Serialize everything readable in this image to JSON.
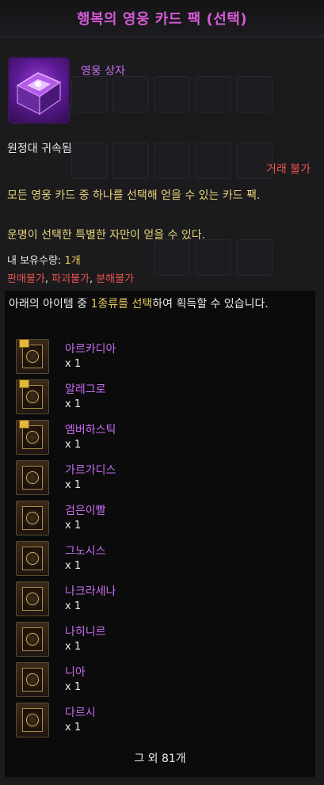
{
  "title": "행복의 영웅 카드 팩 (선택)",
  "item": {
    "name": "영웅 상자",
    "icon": "purple-card-box-icon"
  },
  "bound_text": "원정대 귀속됨",
  "trade_text": "거래 불가",
  "description": [
    "모든 영웅 카드 중 하나를 선택해 얻을 수 있는 카드 팩.",
    "운명이 선택한 특별한 자만이 얻을 수 있다."
  ],
  "owned": {
    "label": "내 보유수량: ",
    "count": "1개"
  },
  "restrictions": [
    "판매불가",
    "파괴불가",
    "분해불가"
  ],
  "panel": {
    "intro_before": "아래의 아이템 중 ",
    "intro_highlight": "1종류를 선택",
    "intro_after": "하여 획득할 수 있습니다.",
    "items": [
      {
        "name": "아르카디아",
        "qty": "x 1",
        "flag": true
      },
      {
        "name": "알레그로",
        "qty": "x 1",
        "flag": true
      },
      {
        "name": "엠버하스틱",
        "qty": "x 1",
        "flag": true
      },
      {
        "name": "가르가디스",
        "qty": "x 1",
        "flag": false
      },
      {
        "name": "검은이빨",
        "qty": "x 1",
        "flag": false
      },
      {
        "name": "그노시스",
        "qty": "x 1",
        "flag": false
      },
      {
        "name": "나크라세나",
        "qty": "x 1",
        "flag": false
      },
      {
        "name": "나히니르",
        "qty": "x 1",
        "flag": false
      },
      {
        "name": "니아",
        "qty": "x 1",
        "flag": false
      },
      {
        "name": "다르시",
        "qty": "x 1",
        "flag": false
      }
    ],
    "more_text": "그 외 81개"
  },
  "colors": {
    "title": "#d65bd6",
    "item_name": "#c86cf0",
    "warning": "#e8534c",
    "description": "#e6d27a",
    "highlight": "#e6c85a"
  }
}
